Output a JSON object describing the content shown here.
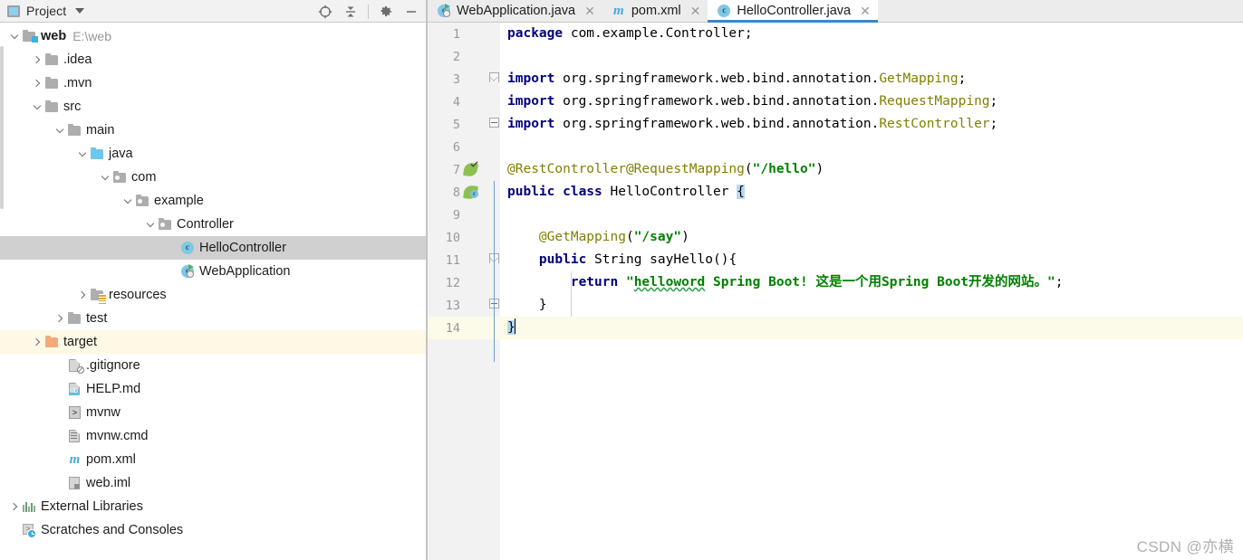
{
  "project_panel": {
    "title": "Project",
    "icon": "project-icon",
    "dropdown_icon": "chevron-down-icon",
    "tools": [
      {
        "name": "locate-icon",
        "glyph": "target"
      },
      {
        "name": "collapse-all-icon",
        "glyph": "collapse"
      },
      {
        "name": "settings-gear-icon",
        "glyph": "gear"
      },
      {
        "name": "hide-panel-icon",
        "glyph": "minus"
      }
    ],
    "tree": [
      {
        "label": "web",
        "path": "E:\\web",
        "depth": 0,
        "twisty": "down",
        "icon": "module-folder-icon",
        "bold": true,
        "state": "normal"
      },
      {
        "label": ".idea",
        "path": "",
        "depth": 1,
        "twisty": "right",
        "icon": "folder-icon",
        "bold": false,
        "state": "normal"
      },
      {
        "label": ".mvn",
        "path": "",
        "depth": 1,
        "twisty": "right",
        "icon": "folder-icon",
        "bold": false,
        "state": "normal"
      },
      {
        "label": "src",
        "path": "",
        "depth": 1,
        "twisty": "down",
        "icon": "folder-icon",
        "bold": false,
        "state": "normal"
      },
      {
        "label": "main",
        "path": "",
        "depth": 2,
        "twisty": "down",
        "icon": "folder-icon",
        "bold": false,
        "state": "normal"
      },
      {
        "label": "java",
        "path": "",
        "depth": 3,
        "twisty": "down",
        "icon": "source-folder-icon",
        "bold": false,
        "state": "normal"
      },
      {
        "label": "com",
        "path": "",
        "depth": 4,
        "twisty": "down",
        "icon": "package-icon",
        "bold": false,
        "state": "normal"
      },
      {
        "label": "example",
        "path": "",
        "depth": 5,
        "twisty": "down",
        "icon": "package-icon",
        "bold": false,
        "state": "normal"
      },
      {
        "label": "Controller",
        "path": "",
        "depth": 6,
        "twisty": "down",
        "icon": "package-icon",
        "bold": false,
        "state": "normal"
      },
      {
        "label": "HelloController",
        "path": "",
        "depth": 7,
        "twisty": "none",
        "icon": "java-class-icon",
        "bold": false,
        "state": "selected"
      },
      {
        "label": "WebApplication",
        "path": "",
        "depth": 7,
        "twisty": "none",
        "icon": "spring-boot-app-icon",
        "bold": false,
        "state": "normal"
      },
      {
        "label": "resources",
        "path": "",
        "depth": 3,
        "twisty": "right",
        "icon": "resources-folder-icon",
        "bold": false,
        "state": "normal"
      },
      {
        "label": "test",
        "path": "",
        "depth": 2,
        "twisty": "right",
        "icon": "folder-icon",
        "bold": false,
        "state": "normal"
      },
      {
        "label": "target",
        "path": "",
        "depth": 1,
        "twisty": "right",
        "icon": "excluded-folder-icon",
        "bold": false,
        "state": "highlight"
      },
      {
        "label": ".gitignore",
        "path": "",
        "depth": 2,
        "twisty": "none",
        "icon": "gitignore-file-icon",
        "bold": false,
        "state": "normal"
      },
      {
        "label": "HELP.md",
        "path": "",
        "depth": 2,
        "twisty": "none",
        "icon": "markdown-file-icon",
        "bold": false,
        "state": "normal"
      },
      {
        "label": "mvnw",
        "path": "",
        "depth": 2,
        "twisty": "none",
        "icon": "shell-script-icon",
        "bold": false,
        "state": "normal"
      },
      {
        "label": "mvnw.cmd",
        "path": "",
        "depth": 2,
        "twisty": "none",
        "icon": "cmd-script-icon",
        "bold": false,
        "state": "normal"
      },
      {
        "label": "pom.xml",
        "path": "",
        "depth": 2,
        "twisty": "none",
        "icon": "maven-file-icon",
        "bold": false,
        "state": "normal"
      },
      {
        "label": "web.iml",
        "path": "",
        "depth": 2,
        "twisty": "none",
        "icon": "iml-file-icon",
        "bold": false,
        "state": "normal"
      },
      {
        "label": "External Libraries",
        "path": "",
        "depth": 0,
        "twisty": "right",
        "icon": "libraries-icon",
        "bold": false,
        "state": "normal"
      },
      {
        "label": "Scratches and Consoles",
        "path": "",
        "depth": 0,
        "twisty": "none",
        "icon": "scratches-icon",
        "bold": false,
        "state": "normal"
      }
    ]
  },
  "editor": {
    "tabs": [
      {
        "label": "WebApplication.java",
        "icon": "spring-boot-app-icon",
        "active": false,
        "close_icon": "close-icon"
      },
      {
        "label": "pom.xml",
        "icon": "maven-file-icon",
        "active": false,
        "close_icon": "close-icon"
      },
      {
        "label": "HelloController.java",
        "icon": "java-class-icon",
        "active": true,
        "close_icon": "close-icon"
      }
    ],
    "active_tab": "HelloController.java",
    "current_line": 14,
    "lines": [
      {
        "n": 1,
        "gutter_icon": "",
        "fold": "",
        "text": "package com.example.Controller;"
      },
      {
        "n": 2,
        "gutter_icon": "",
        "fold": "",
        "text": ""
      },
      {
        "n": 3,
        "gutter_icon": "",
        "fold": "top",
        "text": "import org.springframework.web.bind.annotation.GetMapping;"
      },
      {
        "n": 4,
        "gutter_icon": "",
        "fold": "",
        "text": "import org.springframework.web.bind.annotation.RequestMapping;"
      },
      {
        "n": 5,
        "gutter_icon": "",
        "fold": "bottom",
        "text": "import org.springframework.web.bind.annotation.RestController;"
      },
      {
        "n": 6,
        "gutter_icon": "",
        "fold": "",
        "text": ""
      },
      {
        "n": 7,
        "gutter_icon": "spring-bean-icon",
        "fold": "",
        "text": "@RestController@RequestMapping(\"/hello\")"
      },
      {
        "n": 8,
        "gutter_icon": "spring-class-icon",
        "fold": "",
        "text": "public class HelloController {"
      },
      {
        "n": 9,
        "gutter_icon": "",
        "fold": "",
        "text": ""
      },
      {
        "n": 10,
        "gutter_icon": "",
        "fold": "",
        "text": "    @GetMapping(\"/say\")"
      },
      {
        "n": 11,
        "gutter_icon": "",
        "fold": "top",
        "text": "    public String sayHello(){"
      },
      {
        "n": 12,
        "gutter_icon": "",
        "fold": "",
        "text": "        return \"helloword Spring Boot! 这是一个用Spring Boot开发的网站。\";"
      },
      {
        "n": 13,
        "gutter_icon": "",
        "fold": "bottom",
        "text": "    }"
      },
      {
        "n": 14,
        "gutter_icon": "",
        "fold": "",
        "text": "}"
      }
    ],
    "tokens": {
      "keywords": [
        "package",
        "import",
        "public",
        "class",
        "return",
        "String"
      ],
      "string_literals": [
        "\"/hello\"",
        "\"/say\"",
        "\"helloword Spring Boot! 这是一个用Spring Boot开发的网站。\""
      ],
      "annotations": [
        "@RestController",
        "@RequestMapping",
        "@GetMapping"
      ],
      "misspelled_word": "helloword"
    }
  },
  "colors": {
    "keyword": "#000080",
    "string": "#008000",
    "annotation": "#808000",
    "class_ref": "#808000",
    "selection": "#b7d8f0",
    "current_line": "#fcfae8",
    "tab_active_underline": "#3a86c8",
    "tree_selection": "#d0d0d0",
    "tree_highlight": "#fdf9e4",
    "gutter_bg": "#f2f2f2",
    "panel_header_bg": "#f2f2f2"
  },
  "watermark": {
    "text": "CSDN @亦横"
  }
}
